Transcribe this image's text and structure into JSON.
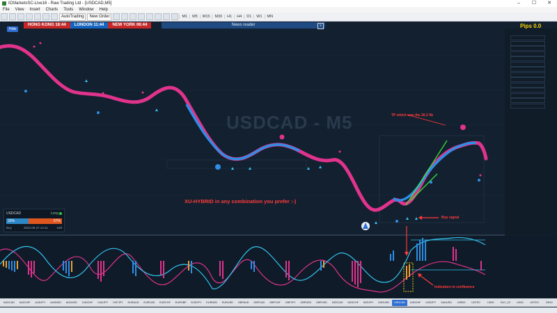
{
  "window": {
    "title": "ICMarketsSC-Live16 - Raw Trading Ltd - [USDCAD,M5]",
    "minimize": "–",
    "maximize": "☐",
    "close": "✕"
  },
  "menu": [
    "File",
    "View",
    "Insert",
    "Charts",
    "Tools",
    "Window",
    "Help"
  ],
  "toolbar": {
    "autotrading": "AutoTrading",
    "new_order": "New Order",
    "timeframes": [
      "M1",
      "M5",
      "M15",
      "M30",
      "H1",
      "H4",
      "D1",
      "W1",
      "MN"
    ]
  },
  "sessions": [
    {
      "name": "HONG KONG",
      "time": "18:44",
      "color": "#c62828"
    },
    {
      "name": "LONDON",
      "time": "11:44",
      "color": "#1565c0"
    },
    {
      "name": "NEW YORK",
      "time": "06:44",
      "color": "#c62828"
    }
  ],
  "news_bar": {
    "label": "News reader",
    "close": "x"
  },
  "hide_button": "Hide",
  "pips": "Pips 0.0",
  "watermark": "USDCAD - M5",
  "notes": {
    "tp": "TP which was the 26.2 fib",
    "combo": "XU-HYBRID in any combination you prefer :-)",
    "buy": "Buy signal",
    "confluence": "Indicators in confluence"
  },
  "signal_panel": {
    "symbol": "USDCAD",
    "direction": "Long",
    "buy_pct": "33%",
    "sell_pct": "67%",
    "buy": "Buy",
    "time": "2022.09.27 12:41",
    "sell": "Sell"
  },
  "symbol_tabs": [
    "AUDCAD",
    "AUDCHF",
    "AUDJPY",
    "AUDNZD",
    "AUDUSD",
    "CADCHF",
    "CADJPY",
    "CHFJPY",
    "EURAUD",
    "EURCAD",
    "EURCHF",
    "EURGBP",
    "EURJPY",
    "EURNZD",
    "EURUSD",
    "GBPAUD",
    "GBPCAD",
    "GBPCHF",
    "GBPJPY",
    "GBPNZD",
    "GBPUSD",
    "NZDCAD",
    "NZDCHF",
    "NZDJPY",
    "NZDUSD",
    "USDCAD",
    "USDCHF",
    "USDJPY",
    "XAUUSD",
    "US500",
    "USTEC",
    "US30",
    "DXY_Z2",
    "US30",
    "USTEC",
    "DE40"
  ],
  "active_symbol": "USDCAD",
  "colors": {
    "pink": "#e0338c",
    "blue": "#2e8ee6",
    "cyan": "#35c4f0",
    "green": "#39e639",
    "red": "#ff3b3b",
    "orange": "#f0a030",
    "yellow": "#ffd400"
  }
}
